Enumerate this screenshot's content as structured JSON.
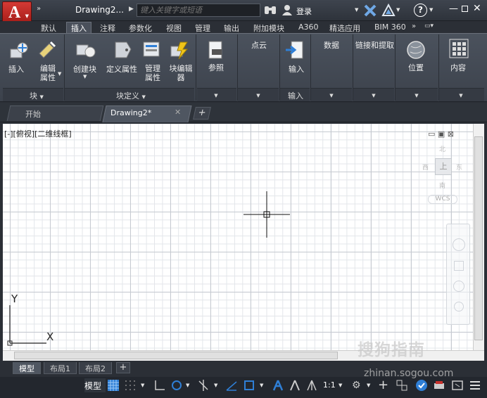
{
  "titlebar": {
    "doc_title": "Drawing2...",
    "search_placeholder": "键入关键字或短语",
    "login": "登录"
  },
  "tabs": [
    "默认",
    "插入",
    "注释",
    "参数化",
    "视图",
    "管理",
    "输出",
    "附加模块",
    "A360",
    "精选应用",
    "BIM 360"
  ],
  "active_tab": "插入",
  "ribbon": {
    "insert_label": "插入",
    "edit_attr_label": "编辑属性",
    "create_block_label": "创建块",
    "define_attr_label": "定义属性",
    "manage_attr_label": "管理属性",
    "block_editor_label": "块编辑器",
    "reference_label": "参照",
    "pointcloud_label": "点云",
    "import_label": "输入",
    "data_label": "数据",
    "link_extract_label": "链接和提取",
    "location_label": "位置",
    "content_label": "内容",
    "panel_block": "块",
    "panel_block_def": "块定义",
    "panel_import": "输入"
  },
  "file_tabs": {
    "start": "开始",
    "drawing": "Drawing2*",
    "add": "+"
  },
  "viewport": {
    "label": "[-][俯视][二维线框]",
    "ucs_x": "X",
    "ucs_y": "Y",
    "viewcube_top": "上",
    "viewcube_n": "北",
    "viewcube_w": "西",
    "viewcube_e": "东",
    "viewcube_s": "南",
    "wcs": "WCS"
  },
  "layout_tabs": [
    "模型",
    "布局1",
    "布局2"
  ],
  "active_layout": "模型",
  "statusbar": {
    "model": "模型",
    "scale": "1:1"
  },
  "watermark": {
    "brand": "搜狗指南",
    "url": "zhinan.sogou.com"
  },
  "colors": {
    "accent_red": "#c8302b",
    "ribbon_bg": "#444a54",
    "canvas_bg": "#ffffff",
    "status_blue": "#2f7fd6"
  }
}
